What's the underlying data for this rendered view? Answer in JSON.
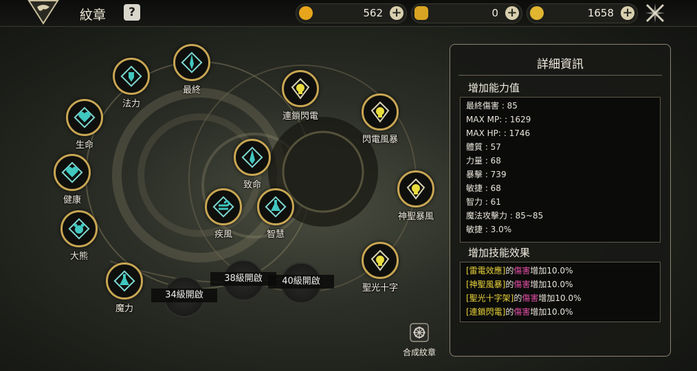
{
  "header": {
    "title": "紋章",
    "help_label": "?"
  },
  "currencies": [
    {
      "name": "crystal-currency",
      "value": "562",
      "color": "#e7a51c"
    },
    {
      "name": "gold-badge-currency",
      "value": "0",
      "color": "#d9a422"
    },
    {
      "name": "coin-currency",
      "value": "1658",
      "color": "#e2b531"
    }
  ],
  "nodes": [
    {
      "id": "fali",
      "label": "法力",
      "icon": "fist-icon",
      "icon_color": "#3fc7c0"
    },
    {
      "id": "zuizhong",
      "label": "最終",
      "icon": "sword-icon",
      "icon_color": "#3fc7c0"
    },
    {
      "id": "shengming",
      "label": "生命",
      "icon": "heart-icon",
      "icon_color": "#3fc7c0"
    },
    {
      "id": "jiankang",
      "label": "健康",
      "icon": "heart-icon",
      "icon_color": "#3fc7c0"
    },
    {
      "id": "daxiong",
      "label": "大熊",
      "icon": "bear-icon",
      "icon_color": "#3fc7c0"
    },
    {
      "id": "moli",
      "label": "魔力",
      "icon": "potion-icon",
      "icon_color": "#3fc7c0"
    },
    {
      "id": "zhiming",
      "label": "致命",
      "icon": "dagger-icon",
      "icon_color": "#3fc7c0"
    },
    {
      "id": "jifeng",
      "label": "疾風",
      "icon": "wind-icon",
      "icon_color": "#3fc7c0"
    },
    {
      "id": "zhihui",
      "label": "智慧",
      "icon": "flask-icon",
      "icon_color": "#3fc7c0"
    },
    {
      "id": "lianshuo",
      "label": "連鎖閃電",
      "icon": "skull-icon",
      "icon_color": "#e8dc3e"
    },
    {
      "id": "shandian",
      "label": "閃電風暴",
      "icon": "skull-icon",
      "icon_color": "#e8dc3e"
    },
    {
      "id": "shensheng",
      "label": "神聖暴風",
      "icon": "skull-icon",
      "icon_color": "#e8dc3e"
    },
    {
      "id": "shengguang",
      "label": "聖光十字",
      "icon": "skull-icon",
      "icon_color": "#e8dc3e"
    }
  ],
  "locked_slots": [
    "34級開啟",
    "38級開啟",
    "40級開啟"
  ],
  "panel": {
    "title": "詳細資訊",
    "stats_header": "增加能力值",
    "stats": [
      "最終傷害 : 85",
      "MAX MP:   : 1629",
      "MAX HP:   : 1746",
      "體質 : 57",
      "力量 : 68",
      "暴擊 : 739",
      "敏捷 : 68",
      "智力 : 61",
      "魔法攻擊力 : 85~85",
      "敏捷 : 3.0%"
    ],
    "effects_header": "增加技能效果",
    "effects": [
      {
        "skill": "[雷電效應]",
        "mid": "的",
        "dmg": "傷害",
        "tail": "增加10.0%"
      },
      {
        "skill": "[神聖風暴]",
        "mid": "的",
        "dmg": "傷害",
        "tail": "增加10.0%"
      },
      {
        "skill": "[聖光十字架]",
        "mid": "的",
        "dmg": "傷害",
        "tail": "增加10.0%"
      },
      {
        "skill": "[連鎖閃電]",
        "mid": "的",
        "dmg": "傷害",
        "tail": "增加10.0%"
      }
    ]
  },
  "synthesize": {
    "label": "合成紋章"
  }
}
